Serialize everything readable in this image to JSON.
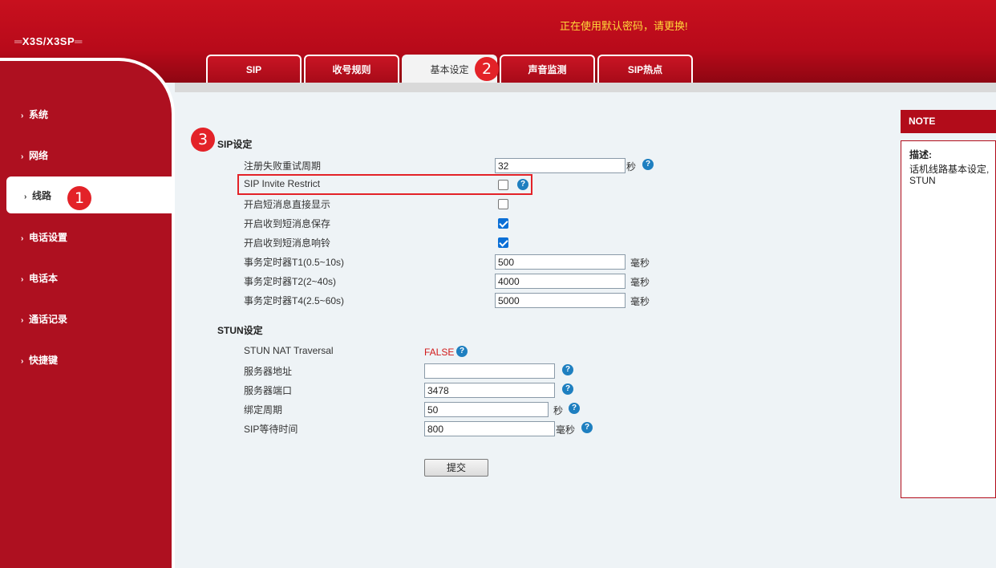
{
  "header": {
    "logo": "X3S/X3SP",
    "warning": "正在使用默认密码，请更换!"
  },
  "tabs": [
    "SIP",
    "收号规则",
    "基本设定",
    "声音监测",
    "SIP热点"
  ],
  "sidebar": {
    "items": [
      "系统",
      "网络",
      "线路",
      "电话设置",
      "电话本",
      "通话记录",
      "快捷键"
    ],
    "active": "线路"
  },
  "badges": [
    "1",
    "2",
    "3"
  ],
  "sip_section": {
    "title": "SIP设定",
    "retry_label": "注册失败重试周期",
    "retry_value": "32",
    "retry_unit": "秒",
    "invite_restrict_label": "SIP Invite Restrict",
    "sms_display_label": "开启短消息直接显示",
    "sms_save_label": "开启收到短消息保存",
    "sms_ring_label": "开启收到短消息响铃",
    "t1_label": "事务定时器T1(0.5~10s)",
    "t1_value": "500",
    "t2_label": "事务定时器T2(2~40s)",
    "t2_value": "4000",
    "t4_label": "事务定时器T4(2.5~60s)",
    "t4_value": "5000",
    "ms_unit": "毫秒"
  },
  "stun_section": {
    "title": "STUN设定",
    "nat_label": "STUN NAT Traversal",
    "nat_value": "FALSE",
    "server_label": "服务器地址",
    "server_value": "",
    "port_label": "服务器端口",
    "port_value": "3478",
    "bind_label": "绑定周期",
    "bind_value": "50",
    "bind_unit": "秒",
    "wait_label": "SIP等待时间",
    "wait_value": "800",
    "wait_unit": "毫秒"
  },
  "submit_label": "提交",
  "help_glyph": "?",
  "chevron_glyph": "›",
  "note": {
    "title": "NOTE",
    "desc_title": "描述:",
    "desc_line1": "话机线路基本设定,",
    "desc_line2": "STUN"
  },
  "checkboxes": {
    "invite_restrict": false,
    "sms_display": false,
    "sms_save": true,
    "sms_ring": true
  },
  "colors": {
    "brand_red": "#b80a1a",
    "warning_yellow": "#ffd93a",
    "badge_red": "#e32228",
    "help_blue": "#1e7fc0"
  }
}
